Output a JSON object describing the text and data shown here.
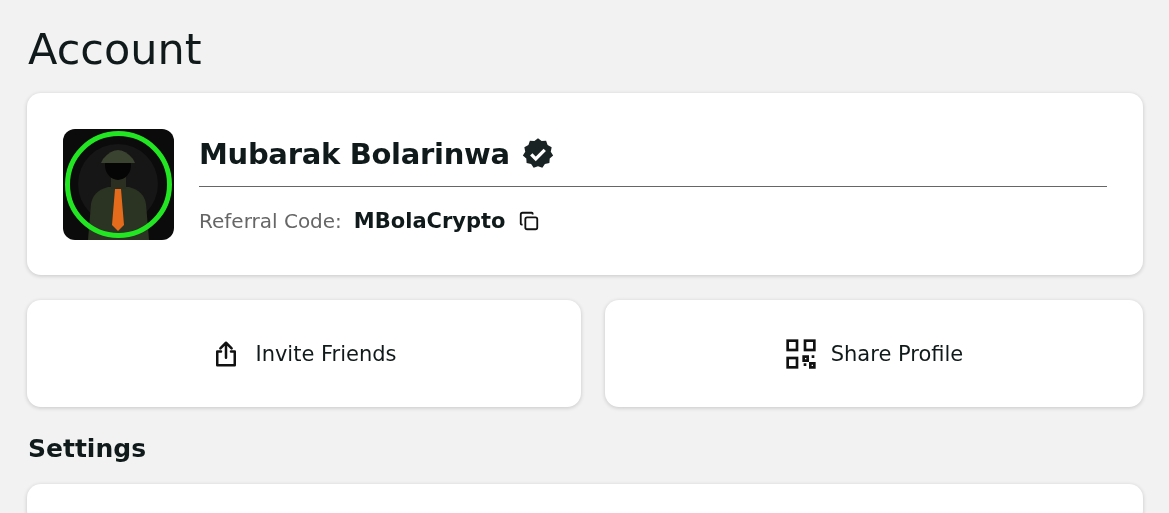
{
  "page": {
    "title": "Account"
  },
  "profile": {
    "name": "Mubarak Bolarinwa",
    "verified": true,
    "referral_label": "Referral Code:",
    "referral_code": "MBolaCrypto"
  },
  "actions": [
    {
      "kind": "share",
      "label": "Invite Friends"
    },
    {
      "kind": "qr",
      "label": "Share Profile"
    }
  ],
  "settings": {
    "title": "Settings"
  }
}
